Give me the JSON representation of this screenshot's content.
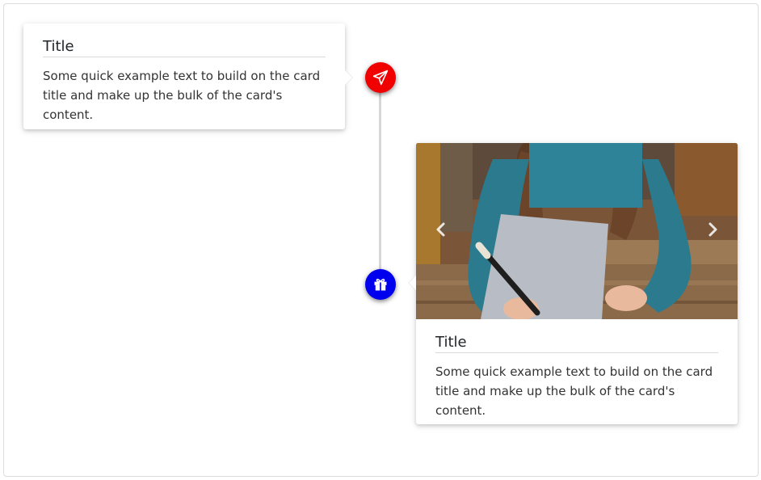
{
  "timeline": {
    "items": [
      {
        "title": "Title",
        "text": "Some quick example text to build on the card title and make up the bulk of the card's content.",
        "icon": "paper-plane-icon",
        "icon_color": "#f00000"
      },
      {
        "title": "Title",
        "text": "Some quick example text to build on the card title and make up the bulk of the card's content.",
        "icon": "gift-icon",
        "icon_color": "#0000ee",
        "image": "photo-child-drawing",
        "carousel": {
          "prev_icon": "chevron-left-icon",
          "next_icon": "chevron-right-icon"
        }
      }
    ]
  }
}
